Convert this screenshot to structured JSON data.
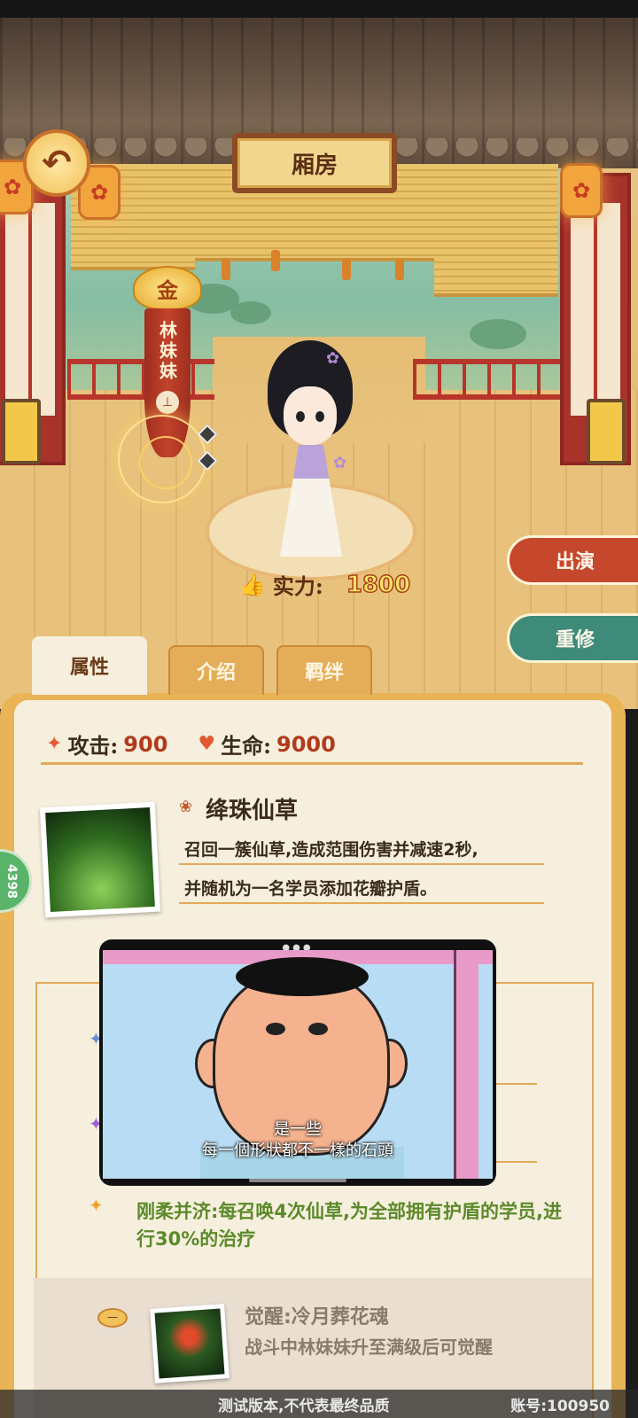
{
  "header": {
    "room_title": "厢房"
  },
  "hero": {
    "rank": "金",
    "name": "林妹妹",
    "banner_knot": "⊥",
    "power_label": "实力:",
    "power_value": "1800"
  },
  "actions": {
    "perform_label": "出演",
    "reset_label": "重修"
  },
  "tabs": [
    {
      "label": "属性",
      "active": true
    },
    {
      "label": "介绍",
      "active": false
    },
    {
      "label": "羁绊",
      "active": false
    }
  ],
  "stats": {
    "attack_label": "攻击:",
    "attack_value": "900",
    "hp_label": "生命:",
    "hp_value": "9000"
  },
  "skill": {
    "name": "绛珠仙草",
    "desc_line1": "召回一簇仙草,造成范围伤害并减速2秒,",
    "desc_line2": "并随机为一名学员添加花瓣护盾。",
    "upgrade_text": "刚柔并济:每召唤4次仙草,为全部拥有护盾的学员,进行30%的治疗"
  },
  "awaken": {
    "badge": "一",
    "title": "觉醒:冷月葬花魂",
    "desc": "战斗中林妹妹升至满级后可觉醒"
  },
  "side_counter": "4398",
  "video": {
    "caption_line1": "是一些",
    "caption_line2": "每一個形狀都不一樣的石頭"
  },
  "footer": {
    "build_notice": "测试版本,不代表最终品质",
    "account_id": "账号:100950"
  },
  "colors": {
    "accent_red": "#c5472c",
    "accent_teal": "#3d8b78",
    "panel_gold": "#e9b455",
    "upgrade_green": "#5b8a2a"
  }
}
